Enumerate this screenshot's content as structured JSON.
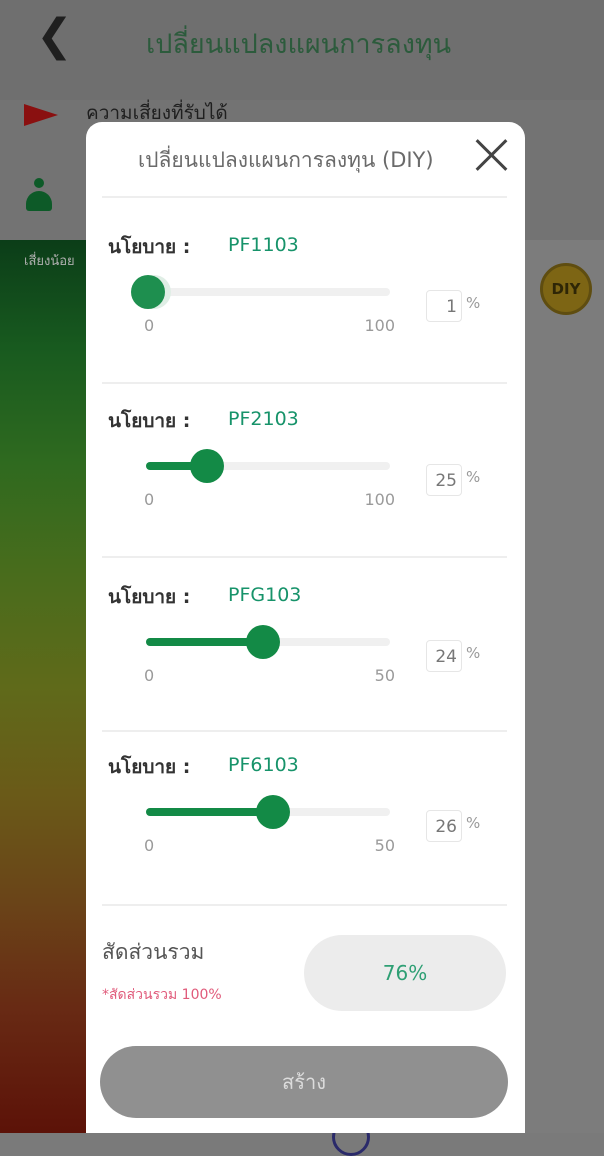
{
  "header": {
    "back_icon": "chevron-left-icon",
    "title": "เปลี่ยนแปลงแผนการลงทุน"
  },
  "risk": {
    "label": "ความเสี่ยงที่รับได้",
    "flag_color": "#8a1010"
  },
  "side": {
    "gradient_label": "เสี่ยงน้อย",
    "badge": "DIY"
  },
  "modal": {
    "title": "เปลี่ยนแปลงแผนการลงทุน (DIY)",
    "close_icon": "close-icon",
    "funds": [
      {
        "label": "นโยบาย :",
        "code": "PF1103",
        "min": "0",
        "max": "100",
        "value": "1",
        "unit": "%",
        "fraction": 0.01
      },
      {
        "label": "นโยบาย :",
        "code": "PF2103",
        "min": "0",
        "max": "100",
        "value": "25",
        "unit": "%",
        "fraction": 0.25
      },
      {
        "label": "นโยบาย :",
        "code": "PFG103",
        "min": "0",
        "max": "50",
        "value": "24",
        "unit": "%",
        "fraction": 0.48
      },
      {
        "label": "นโยบาย :",
        "code": "PF6103",
        "min": "0",
        "max": "50",
        "value": "26",
        "unit": "%",
        "fraction": 0.52
      }
    ],
    "summary": {
      "label": "สัดส่วนรวม",
      "note": "*สัดส่วนรวม 100%",
      "total": "76%"
    },
    "create_button": "สร้าง"
  },
  "colors": {
    "accent": "#138a46",
    "total_text": "#2e9f74",
    "warning": "#e05a7a"
  }
}
